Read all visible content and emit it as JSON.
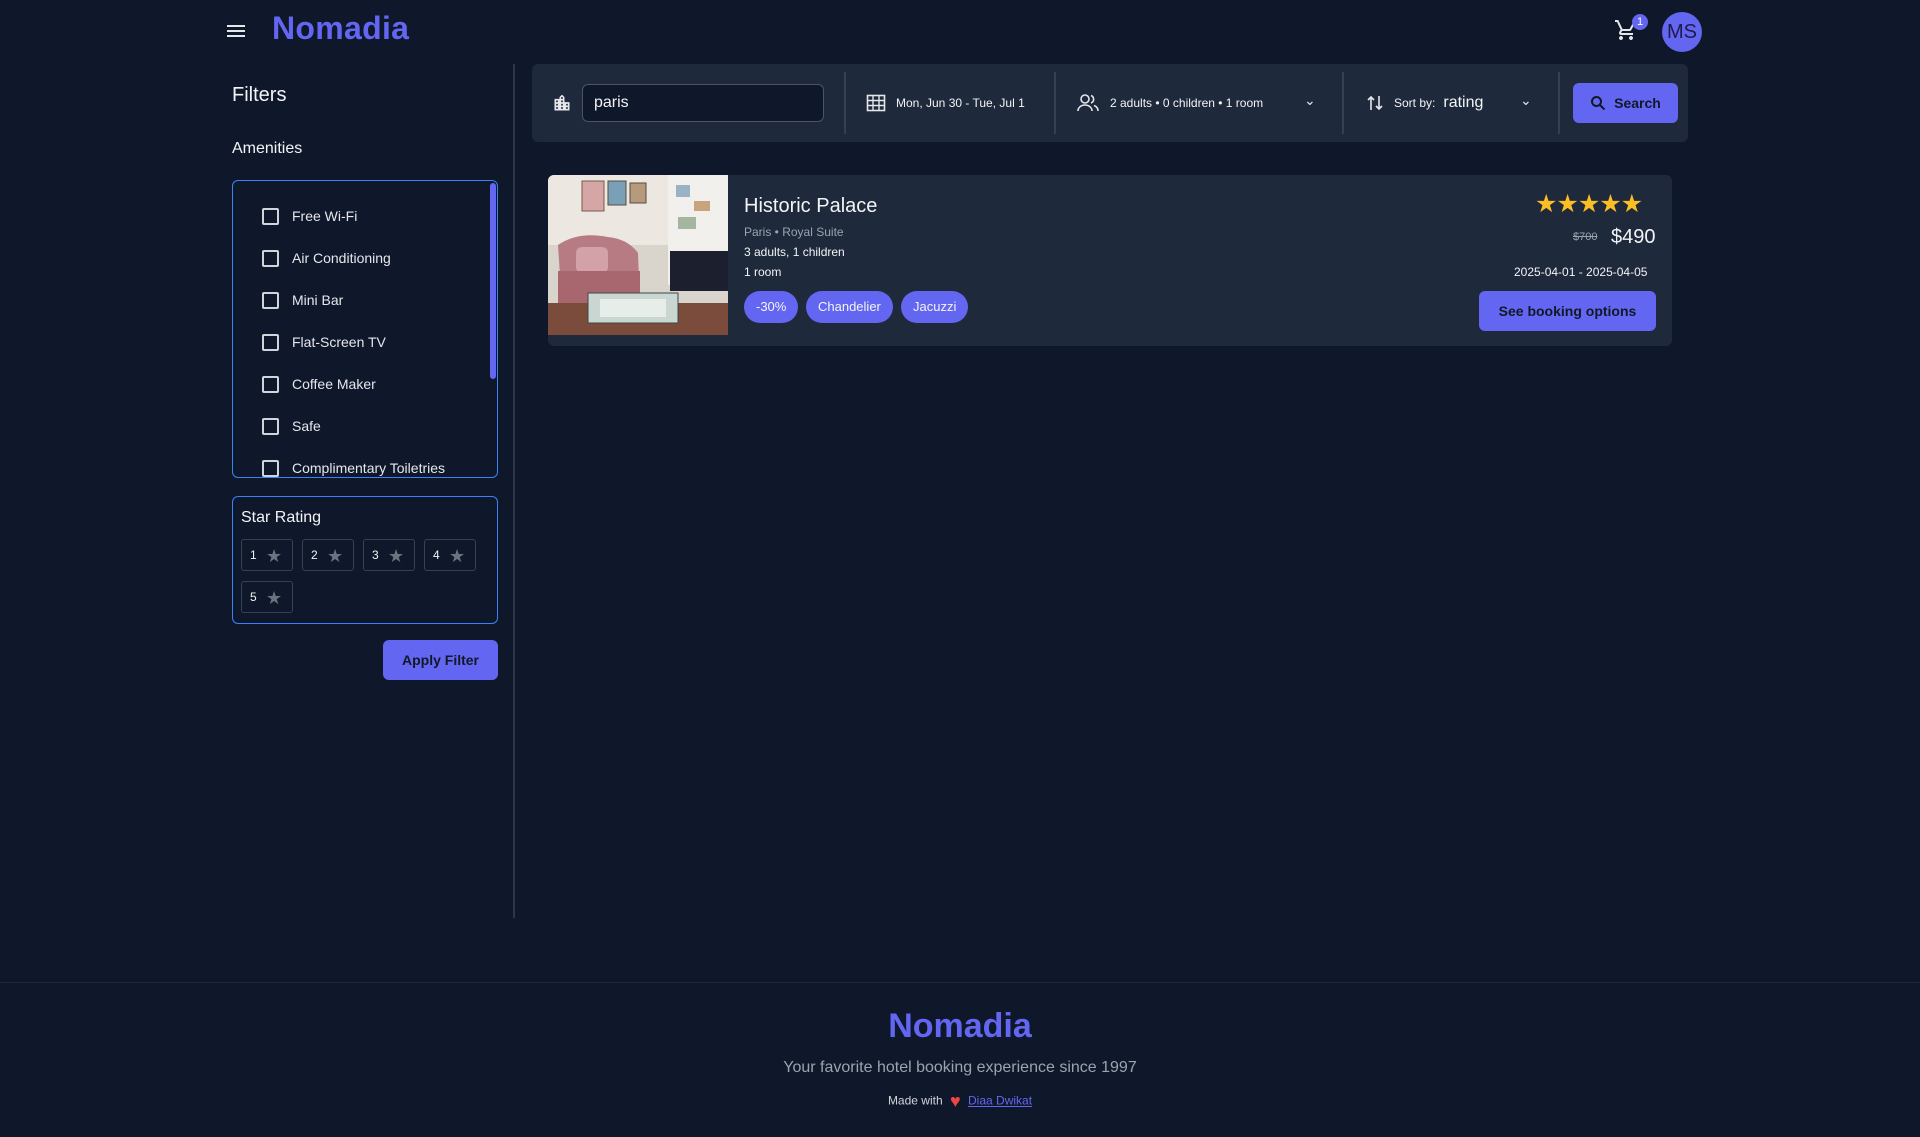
{
  "header": {
    "logo": "Nomadia",
    "cart_count": "1",
    "avatar_initials": "MS"
  },
  "sidebar": {
    "title": "Filters",
    "amenities_title": "Amenities",
    "amenities": [
      "Free Wi-Fi",
      "Air Conditioning",
      "Mini Bar",
      "Flat-Screen TV",
      "Coffee Maker",
      "Safe",
      "Complimentary Toiletries"
    ],
    "star_title": "Star Rating",
    "star_options": [
      "1",
      "2",
      "3",
      "4",
      "5"
    ],
    "apply_label": "Apply Filter"
  },
  "search": {
    "city_value": "paris",
    "dates": "Mon, Jun 30 - Tue, Jul 1",
    "guests": "2 adults • 0 children • 1 room",
    "sort_label": "Sort by:",
    "sort_value": "rating",
    "button_label": "Search"
  },
  "results": [
    {
      "title": "Historic Palace",
      "subtitle": "Paris • Royal Suite",
      "guests": "3 adults, 1 children",
      "rooms": "1 room",
      "chips": [
        "-30%",
        "Chandelier",
        "Jacuzzi"
      ],
      "stars": "★★★★★",
      "rating": 5,
      "old_price": "$700",
      "new_price": "$490",
      "dates": "2025-04-01 - 2025-04-05",
      "button_label": "See booking options"
    }
  ],
  "footer": {
    "logo": "Nomadia",
    "tagline": "Your favorite hotel booking experience since 1997",
    "made_with": "Made with",
    "author": "Diaa Dwikat"
  },
  "colors": {
    "background": "#0f172a",
    "surface": "#1e293b",
    "accent": "#6366f1",
    "star": "#fbbf24"
  }
}
